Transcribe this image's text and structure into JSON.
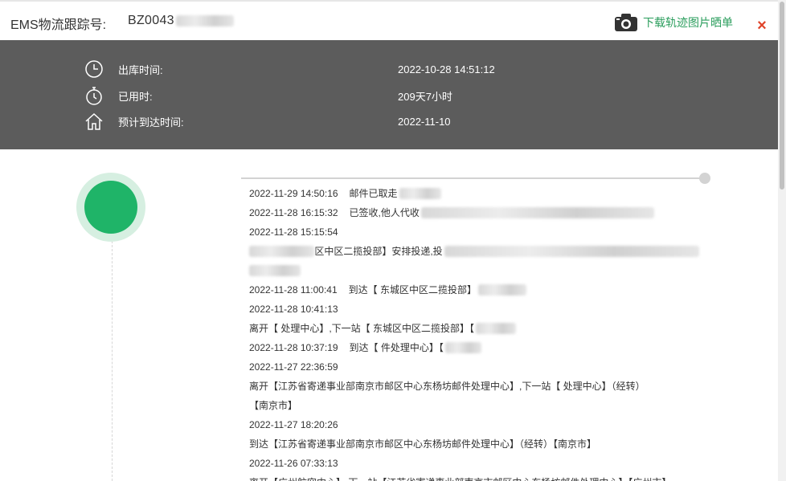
{
  "header": {
    "label": "EMS物流跟踪号:",
    "tracking_prefix": "BZ0043",
    "download_label": "下载轨迹图片晒单",
    "close_label": "×"
  },
  "info": {
    "rows": [
      {
        "icon": "clock-icon",
        "key": "出库时间:",
        "value": "2022-10-28 14:51:12"
      },
      {
        "icon": "stopwatch-icon",
        "key": "已用时:",
        "value": "209天7小时"
      },
      {
        "icon": "home-icon",
        "key": "预计到达时间:",
        "value": "2022-11-10"
      }
    ]
  },
  "events": [
    {
      "time": "2022-11-29 14:50:16",
      "text": "邮件已取走"
    },
    {
      "time": "2022-11-28 16:15:32",
      "text": "已签收,他人代收"
    },
    {
      "time": "2022-11-28 15:15:54",
      "text": ""
    },
    {
      "time": "",
      "text": "区中区二揽投部】安排投递,投"
    },
    {
      "time": "",
      "text": ""
    },
    {
      "time": "2022-11-28 11:00:41",
      "text": "到达【                东城区中区二揽投部】"
    },
    {
      "time": "2022-11-28 10:41:13",
      "text": ""
    },
    {
      "time": "",
      "text": "离开【              处理中心】,下一站【              东城区中区二揽投部】【"
    },
    {
      "time": "2022-11-28 10:37:19",
      "text": "到达【              件处理中心】【"
    },
    {
      "time": "2022-11-27 22:36:59",
      "text": ""
    },
    {
      "time": "",
      "text": "离开【江苏省寄递事业部南京市邮区中心东杨坊邮件处理中心】,下一站【              处理中心】（经转）"
    },
    {
      "time": "",
      "text": "【南京市】"
    },
    {
      "time": "2022-11-27 18:20:26",
      "text": ""
    },
    {
      "time": "",
      "text": "到达【江苏省寄递事业部南京市邮区中心东杨坊邮件处理中心】（经转）【南京市】"
    },
    {
      "time": "2022-11-26 07:33:13",
      "text": ""
    },
    {
      "time": "",
      "text": "离开【广州航空中心】,下一站【江苏省寄递事业部南京市邮区中心东杨坊邮件处理中心】【广州市】"
    }
  ],
  "colors": {
    "accent_green": "#1fb468",
    "link_green": "#2a9d5c",
    "close_red": "#e0442a",
    "info_bg": "#5c5c5c"
  }
}
